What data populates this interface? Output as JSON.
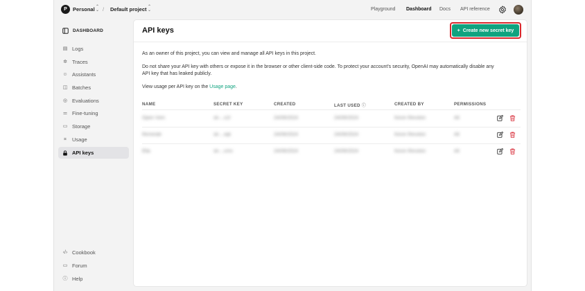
{
  "topbar": {
    "org_initial": "P",
    "org_name": "Personal",
    "separator": "/",
    "project_name": "Default project",
    "nav": [
      "Playground",
      "Dashboard",
      "Docs",
      "API reference"
    ]
  },
  "sidebar": {
    "header": "DASHBOARD",
    "items": [
      {
        "label": "Logs",
        "icon": "logs-icon"
      },
      {
        "label": "Traces",
        "icon": "traces-icon"
      },
      {
        "label": "Assistants",
        "icon": "assistants-icon"
      },
      {
        "label": "Batches",
        "icon": "batches-icon"
      },
      {
        "label": "Evaluations",
        "icon": "evaluations-icon"
      },
      {
        "label": "Fine-tuning",
        "icon": "fine-tuning-icon"
      },
      {
        "label": "Storage",
        "icon": "storage-icon"
      },
      {
        "label": "Usage",
        "icon": "usage-icon"
      },
      {
        "label": "API keys",
        "icon": "key-icon",
        "active": true
      }
    ],
    "footer": [
      {
        "label": "Cookbook",
        "icon": "code-icon"
      },
      {
        "label": "Forum",
        "icon": "forum-icon"
      },
      {
        "label": "Help",
        "icon": "help-icon"
      }
    ]
  },
  "main": {
    "title": "API keys",
    "create_button": "Create new secret key",
    "desc1": "As an owner of this project, you can view and manage all API keys in this project.",
    "desc2a": "Do not share your API key with others or expose it in the browser or other client-side code. To protect your account's security, OpenAI may automatically disable any",
    "desc2b": "API key that has leaked publicly.",
    "desc3_prefix": "View usage per API key on the ",
    "desc3_link": "Usage page",
    "desc3_suffix": "."
  },
  "table": {
    "headers": [
      "NAME",
      "SECRET KEY",
      "CREATED",
      "LAST USED",
      "CREATED BY",
      "PERMISSIONS"
    ],
    "rows": [
      {
        "name": "Open Vom",
        "key": "sk-...s1f",
        "created": "24/09/2024",
        "last_used": "24/09/2024",
        "created_by": "Kevin Revolon",
        "permissions": "All"
      },
      {
        "name": "Reminde",
        "key": "sk-...wjk",
        "created": "24/09/2024",
        "last_used": "24/09/2024",
        "created_by": "Kevin Revolon",
        "permissions": "All"
      },
      {
        "name": "Ella",
        "key": "sk-...cmv",
        "created": "24/09/2024",
        "last_used": "24/09/2024",
        "created_by": "Kevin Revolon",
        "permissions": "All"
      }
    ]
  },
  "colors": {
    "accent": "#10a37f",
    "highlight": "#d8262a",
    "delete": "#d9333f"
  }
}
